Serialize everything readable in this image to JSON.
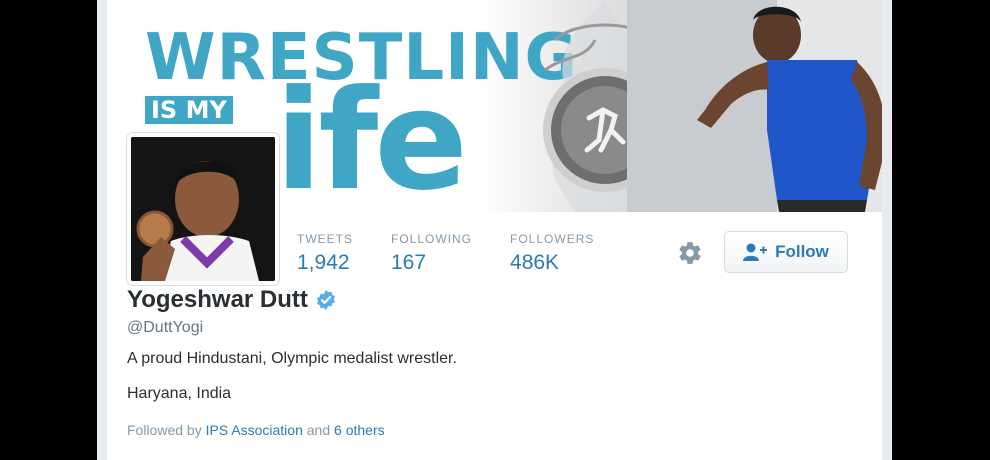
{
  "banner": {
    "line1": "WRESTLING",
    "tag": "IS MY",
    "line2": "ife"
  },
  "profile": {
    "name": "Yogeshwar Dutt",
    "handle": "@DuttYogi",
    "bio": "A proud Hindustani, Olympic medalist wrestler.",
    "location": "Haryana, India",
    "verified": true
  },
  "stats": [
    {
      "label": "TWEETS",
      "value": "1,942"
    },
    {
      "label": "FOLLOWING",
      "value": "167"
    },
    {
      "label": "FOLLOWERS",
      "value": "486K"
    }
  ],
  "actions": {
    "follow_label": "Follow",
    "settings_icon": "gear-icon"
  },
  "followed_by": {
    "prefix": "Followed by",
    "account": "IPS Association",
    "conjunction": "and",
    "others": "6 others"
  },
  "colors": {
    "accent": "#2b7bb9",
    "banner_blue": "#3fa6c6",
    "verified": "#55acee"
  }
}
